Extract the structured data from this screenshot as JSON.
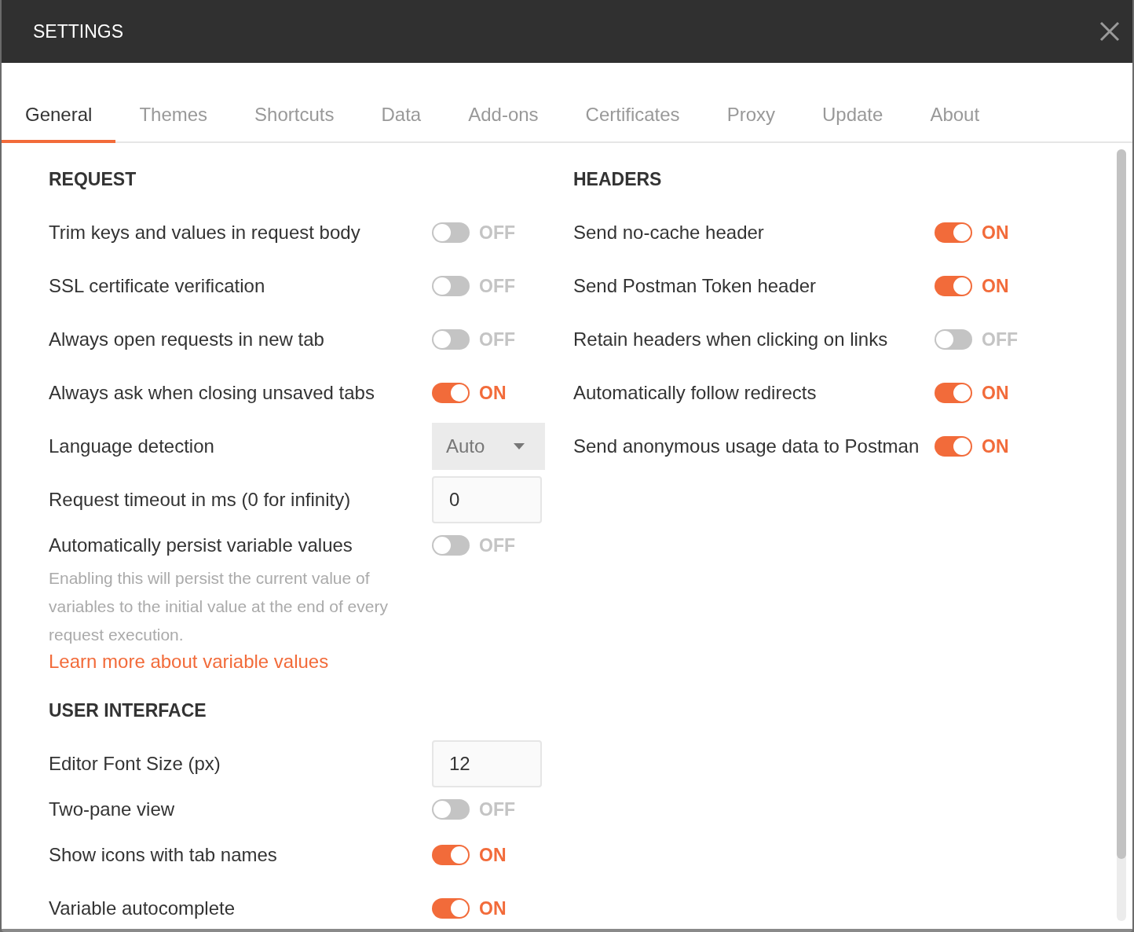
{
  "window": {
    "title": "SETTINGS"
  },
  "tabs": [
    {
      "label": "General",
      "selected": true
    },
    {
      "label": "Themes",
      "selected": false
    },
    {
      "label": "Shortcuts",
      "selected": false
    },
    {
      "label": "Data",
      "selected": false
    },
    {
      "label": "Add-ons",
      "selected": false
    },
    {
      "label": "Certificates",
      "selected": false
    },
    {
      "label": "Proxy",
      "selected": false
    },
    {
      "label": "Update",
      "selected": false
    },
    {
      "label": "About",
      "selected": false
    }
  ],
  "left_sections": [
    {
      "heading": "REQUEST",
      "items": [
        {
          "kind": "toggle",
          "label": "Trim keys and values in request body",
          "on": false,
          "state_label": "OFF"
        },
        {
          "kind": "toggle",
          "label": "SSL certificate verification",
          "on": false,
          "state_label": "OFF"
        },
        {
          "kind": "toggle",
          "label": "Always open requests in new tab",
          "on": false,
          "state_label": "OFF"
        },
        {
          "kind": "toggle",
          "label": "Always ask when closing unsaved tabs",
          "on": true,
          "state_label": "ON"
        },
        {
          "kind": "select",
          "label": "Language detection",
          "value": "Auto"
        },
        {
          "kind": "input",
          "label": "Request timeout in ms (0 for infinity)",
          "value": "0"
        },
        {
          "kind": "toggle",
          "label": "Automatically persist variable values",
          "on": false,
          "state_label": "OFF",
          "note": "Enabling this will persist the current value of variables to the initial value at the end of every request execution.",
          "link": "Learn more about variable values"
        }
      ]
    },
    {
      "heading": "USER INTERFACE",
      "items": [
        {
          "kind": "input",
          "label": "Editor Font Size (px)",
          "value": "12"
        },
        {
          "kind": "toggle",
          "label": "Two-pane view",
          "on": false,
          "state_label": "OFF"
        },
        {
          "kind": "toggle",
          "label": "Show icons with tab names",
          "on": true,
          "state_label": "ON"
        },
        {
          "kind": "toggle",
          "label": "Variable autocomplete",
          "on": true,
          "state_label": "ON"
        }
      ]
    }
  ],
  "right_sections": [
    {
      "heading": "HEADERS",
      "items": [
        {
          "kind": "toggle",
          "label": "Send no-cache header",
          "on": true,
          "state_label": "ON"
        },
        {
          "kind": "toggle",
          "label": "Send Postman Token header",
          "on": true,
          "state_label": "ON"
        },
        {
          "kind": "toggle",
          "label": "Retain headers when clicking on links",
          "on": false,
          "state_label": "OFF"
        },
        {
          "kind": "toggle",
          "label": "Automatically follow redirects",
          "on": true,
          "state_label": "ON"
        },
        {
          "kind": "toggle",
          "label": "Send anonymous usage data to Postman",
          "on": true,
          "state_label": "ON"
        }
      ]
    }
  ]
}
